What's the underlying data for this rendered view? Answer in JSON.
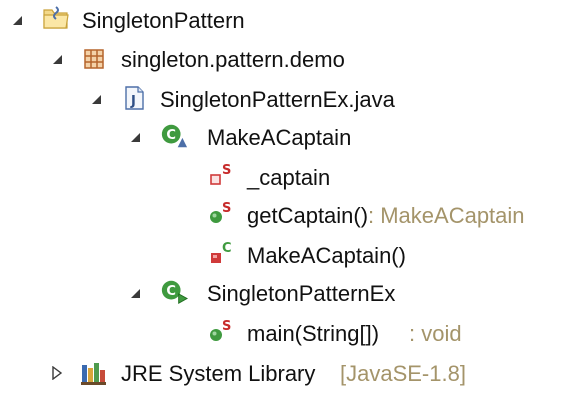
{
  "tree": {
    "project": {
      "label": "SingletonPattern",
      "icon": "java-project-icon",
      "expanded": true
    },
    "package": {
      "label": "singleton.pattern.demo",
      "icon": "package-icon",
      "expanded": true
    },
    "file": {
      "label": "SingletonPatternEx.java",
      "icon": "java-file-icon",
      "expanded": true
    },
    "class_captain": {
      "label": "MakeACaptain",
      "icon": "class-icon",
      "expanded": true,
      "members": {
        "field": {
          "label": "_captain",
          "icon": "private-static-field-icon"
        },
        "method": {
          "label": "getCaptain()",
          "decoration": ": MakeACaptain",
          "icon": "public-static-method-icon"
        },
        "ctor": {
          "label": "MakeACaptain()",
          "icon": "private-constructor-icon"
        }
      }
    },
    "class_main": {
      "label": "SingletonPatternEx",
      "icon": "runnable-class-icon",
      "expanded": true,
      "members": {
        "main": {
          "label": "main(String[])",
          "decoration": ": void",
          "icon": "public-static-method-icon"
        }
      }
    },
    "jre": {
      "label": "JRE System Library",
      "decoration": "[JavaSE-1.8]",
      "icon": "library-icon",
      "expanded": false
    }
  },
  "colors": {
    "twisty": "#3a3a3a",
    "decoration": "#a4946a",
    "class_green": "#3f9a3f",
    "private_red": "#d03a3a",
    "static_red": "#c72b2b",
    "package_brown": "#b5652c",
    "file_blue": "#4d6fa8"
  }
}
